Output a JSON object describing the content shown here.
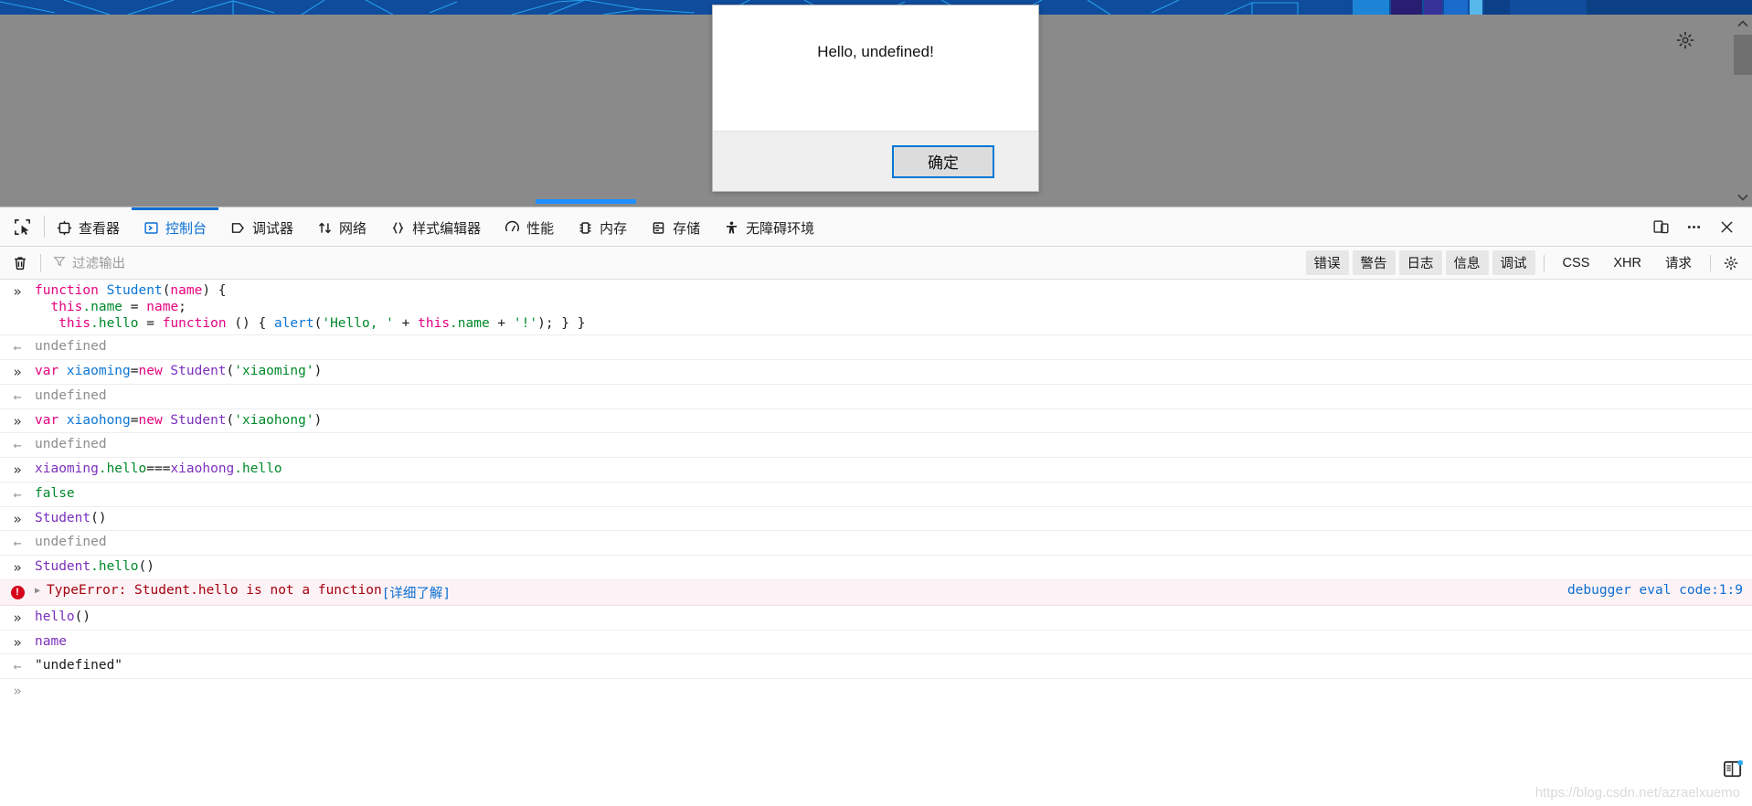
{
  "page": {
    "banner_color": "#0f4c9c",
    "banner_accent": "#27a3f0",
    "dim_color": "#8a8a8a",
    "gear_icon": "gear-icon",
    "scroll_up_icon": "chevron-up-icon",
    "scroll_down_icon": "chevron-down-icon"
  },
  "alert": {
    "message": "Hello, undefined!",
    "ok_label": "确定",
    "focus_color": "#0078d7"
  },
  "devtools": {
    "picker_icon": "element-picker-icon",
    "tabs": [
      {
        "label": "查看器",
        "icon": "inspector-icon",
        "active": false
      },
      {
        "label": "控制台",
        "icon": "console-icon",
        "active": true
      },
      {
        "label": "调试器",
        "icon": "debugger-icon",
        "active": false
      },
      {
        "label": "网络",
        "icon": "network-icon",
        "active": false
      },
      {
        "label": "样式编辑器",
        "icon": "style-editor-icon",
        "active": false
      },
      {
        "label": "性能",
        "icon": "performance-icon",
        "active": false
      },
      {
        "label": "内存",
        "icon": "memory-icon",
        "active": false
      },
      {
        "label": "存储",
        "icon": "storage-icon",
        "active": false
      },
      {
        "label": "无障碍环境",
        "icon": "accessibility-icon",
        "active": false
      }
    ],
    "active_tab_color": "#0b6fd4",
    "toolbar_right": [
      {
        "icon": "responsive-design-mode-icon"
      },
      {
        "icon": "meatball-menu-icon"
      },
      {
        "icon": "close-icon"
      }
    ],
    "filterbar": {
      "clear_icon": "trash-icon",
      "filter_icon": "funnel-icon",
      "filter_placeholder": "过滤输出",
      "filter_value": "",
      "pills": [
        "错误",
        "警告",
        "日志",
        "信息",
        "调试"
      ],
      "plain": [
        "CSS",
        "XHR",
        "请求"
      ],
      "settings_icon": "gear-icon"
    }
  },
  "console": {
    "input_marker": "»",
    "output_marker": "←",
    "rows": [
      {
        "kind": "input",
        "lines": [
          [
            {
              "t": "function ",
              "c": "t-kw"
            },
            {
              "t": "Student",
              "c": "t-fn"
            },
            {
              "t": "(",
              "c": "t-punc"
            },
            {
              "t": "name",
              "c": "t-param"
            },
            {
              "t": ") {",
              "c": "t-punc"
            }
          ],
          [
            {
              "t": "  ",
              "c": "t-plain"
            },
            {
              "t": "this",
              "c": "t-this"
            },
            {
              "t": ".name",
              "c": "t-prop"
            },
            {
              "t": " = ",
              "c": "t-punc"
            },
            {
              "t": "name",
              "c": "t-param"
            },
            {
              "t": ";",
              "c": "t-punc"
            }
          ],
          [
            {
              "t": "   ",
              "c": "t-plain"
            },
            {
              "t": "this",
              "c": "t-this"
            },
            {
              "t": ".hello",
              "c": "t-prop"
            },
            {
              "t": " = ",
              "c": "t-punc"
            },
            {
              "t": "function",
              "c": "t-kw"
            },
            {
              "t": " () { ",
              "c": "t-punc"
            },
            {
              "t": "alert",
              "c": "t-ident"
            },
            {
              "t": "(",
              "c": "t-punc"
            },
            {
              "t": "'Hello, '",
              "c": "t-str"
            },
            {
              "t": " + ",
              "c": "t-punc"
            },
            {
              "t": "this",
              "c": "t-this"
            },
            {
              "t": ".name",
              "c": "t-prop"
            },
            {
              "t": " + ",
              "c": "t-punc"
            },
            {
              "t": "'!'",
              "c": "t-str"
            },
            {
              "t": "); } }",
              "c": "t-punc"
            }
          ]
        ]
      },
      {
        "kind": "output",
        "value": "undefined",
        "cls": "out-undef"
      },
      {
        "kind": "input",
        "lines": [
          [
            {
              "t": "var ",
              "c": "t-kw"
            },
            {
              "t": "xiaoming",
              "c": "t-ident"
            },
            {
              "t": "=",
              "c": "t-punc"
            },
            {
              "t": "new ",
              "c": "t-kw"
            },
            {
              "t": "Student",
              "c": "t-ref"
            },
            {
              "t": "(",
              "c": "t-punc"
            },
            {
              "t": "'xiaoming'",
              "c": "t-str"
            },
            {
              "t": ")",
              "c": "t-punc"
            }
          ]
        ]
      },
      {
        "kind": "output",
        "value": "undefined",
        "cls": "out-undef"
      },
      {
        "kind": "input",
        "lines": [
          [
            {
              "t": "var ",
              "c": "t-kw"
            },
            {
              "t": "xiaohong",
              "c": "t-ident"
            },
            {
              "t": "=",
              "c": "t-punc"
            },
            {
              "t": "new ",
              "c": "t-kw"
            },
            {
              "t": "Student",
              "c": "t-ref"
            },
            {
              "t": "(",
              "c": "t-punc"
            },
            {
              "t": "'xiaohong'",
              "c": "t-str"
            },
            {
              "t": ")",
              "c": "t-punc"
            }
          ]
        ]
      },
      {
        "kind": "output",
        "value": "undefined",
        "cls": "out-undef"
      },
      {
        "kind": "input",
        "lines": [
          [
            {
              "t": "xiaoming",
              "c": "t-ref"
            },
            {
              "t": ".hello",
              "c": "t-prop"
            },
            {
              "t": "===",
              "c": "t-punc"
            },
            {
              "t": "xiaohong",
              "c": "t-ref"
            },
            {
              "t": ".hello",
              "c": "t-prop"
            }
          ]
        ]
      },
      {
        "kind": "output",
        "value": "false",
        "cls": "out-false"
      },
      {
        "kind": "input",
        "lines": [
          [
            {
              "t": "Student",
              "c": "t-ref"
            },
            {
              "t": "()",
              "c": "t-punc"
            }
          ]
        ]
      },
      {
        "kind": "output",
        "value": "undefined",
        "cls": "out-undef"
      },
      {
        "kind": "input",
        "lines": [
          [
            {
              "t": "Student",
              "c": "t-ref"
            },
            {
              "t": ".hello",
              "c": "t-prop"
            },
            {
              "t": "()",
              "c": "t-punc"
            }
          ]
        ]
      },
      {
        "kind": "error",
        "text": "TypeError: Student.hello is not a function",
        "link": "[详细了解]",
        "source": "debugger eval code:1:9"
      },
      {
        "kind": "input",
        "lines": [
          [
            {
              "t": "hello",
              "c": "t-ref"
            },
            {
              "t": "()",
              "c": "t-punc"
            }
          ]
        ]
      },
      {
        "kind": "input",
        "lines": [
          [
            {
              "t": "name",
              "c": "t-ref"
            }
          ]
        ]
      },
      {
        "kind": "output",
        "value": "\"undefined\"",
        "cls": "out-str"
      },
      {
        "kind": "prompt"
      }
    ]
  },
  "watermark": {
    "text": "https://blog.csdn.net/azraelxuemo"
  }
}
